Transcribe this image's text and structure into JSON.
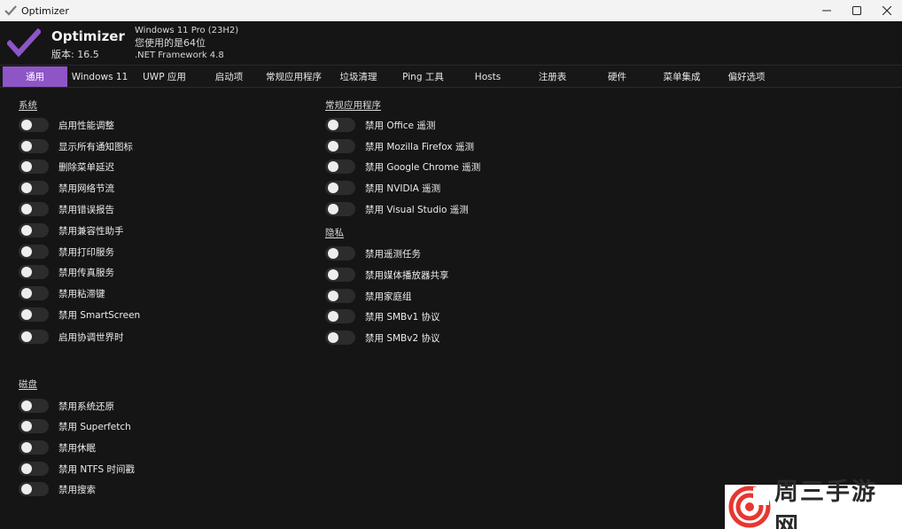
{
  "window": {
    "title": "Optimizer"
  },
  "header": {
    "brand": "Optimizer",
    "version": "版本: 16.5",
    "os": "Windows 11 Pro (23H2)",
    "arch": "您使用的是64位",
    "framework": ".NET Framework 4.8"
  },
  "colors": {
    "accent": "#8e55c7",
    "background": "#151515",
    "toggle_off": "#2c2c2c"
  },
  "tabs": [
    {
      "label": "通用"
    },
    {
      "label": "Windows 11"
    },
    {
      "label": "UWP 应用"
    },
    {
      "label": "启动项"
    },
    {
      "label": "常规应用程序"
    },
    {
      "label": "垃圾清理"
    },
    {
      "label": "Ping 工具"
    },
    {
      "label": "Hosts"
    },
    {
      "label": "注册表"
    },
    {
      "label": "硬件"
    },
    {
      "label": "菜单集成"
    },
    {
      "label": "偏好选项"
    }
  ],
  "sections": {
    "system": {
      "title": "系统",
      "items": [
        {
          "label": "启用性能调整",
          "on": false
        },
        {
          "label": "显示所有通知图标",
          "on": false
        },
        {
          "label": "删除菜单延迟",
          "on": false
        },
        {
          "label": "禁用网络节流",
          "on": false
        },
        {
          "label": "禁用错误报告",
          "on": false
        },
        {
          "label": "禁用兼容性助手",
          "on": false
        },
        {
          "label": "禁用打印服务",
          "on": false
        },
        {
          "label": "禁用传真服务",
          "on": false
        },
        {
          "label": "禁用粘滞键",
          "on": false
        },
        {
          "label": "禁用 SmartScreen",
          "on": false
        },
        {
          "label": "启用协调世界时",
          "on": false
        }
      ]
    },
    "disk": {
      "title": "磁盘",
      "items": [
        {
          "label": "禁用系统还原",
          "on": false
        },
        {
          "label": "禁用 Superfetch",
          "on": false
        },
        {
          "label": "禁用休眠",
          "on": false
        },
        {
          "label": "禁用 NTFS 时间戳",
          "on": false
        },
        {
          "label": "禁用搜索",
          "on": false
        }
      ]
    },
    "apps": {
      "title": "常规应用程序",
      "items": [
        {
          "label": "禁用 Office 遥测",
          "on": false
        },
        {
          "label": "禁用 Mozilla Firefox 遥测",
          "on": false
        },
        {
          "label": "禁用 Google Chrome 遥测",
          "on": false
        },
        {
          "label": "禁用 NVIDIA 遥测",
          "on": false
        },
        {
          "label": "禁用 Visual Studio 遥测",
          "on": false
        }
      ]
    },
    "privacy": {
      "title": "隐私",
      "items": [
        {
          "label": "禁用遥测任务",
          "on": false
        },
        {
          "label": "禁用媒体播放器共享",
          "on": false
        },
        {
          "label": "禁用家庭组",
          "on": false
        },
        {
          "label": "禁用 SMBv1 协议",
          "on": false
        },
        {
          "label": "禁用 SMBv2 协议",
          "on": false
        }
      ]
    }
  },
  "watermark": {
    "text": "周三手游网"
  }
}
